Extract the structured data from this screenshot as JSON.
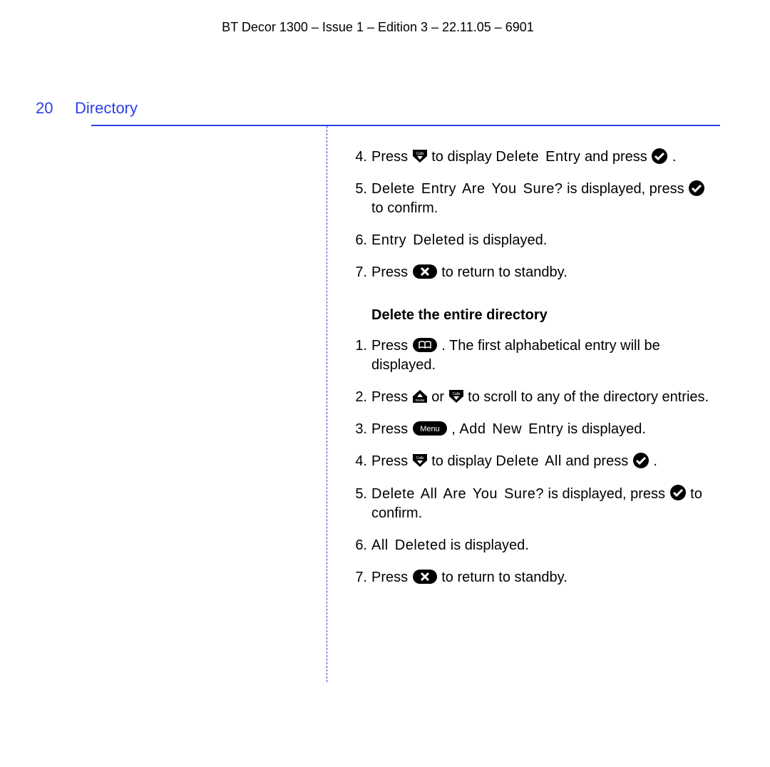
{
  "header": "BT Decor 1300 – Issue 1 – Edition 3 – 22.11.05 – 6901",
  "page_number": "20",
  "section_title": "Directory",
  "subheading": "Delete the entire directory",
  "section_a": {
    "step4_a": "Press ",
    "step4_b": " to display ",
    "step4_lcd": "Delete Entry",
    "step4_c": " and press ",
    "step4_d": ".",
    "step5_lcd": "Delete Entry Are You Sure?",
    "step5_a": " is displayed, press ",
    "step5_b": " to confirm.",
    "step6_lcd": "Entry Deleted",
    "step6_a": " is displayed.",
    "step7_a": "Press ",
    "step7_b": " to return to standby."
  },
  "section_b": {
    "step1_a": "Press ",
    "step1_b": ". The first alphabetical entry will be displayed.",
    "step2_a": "Press ",
    "step2_b": " or ",
    "step2_c": " to scroll to any of the directory entries.",
    "step3_a": "Press ",
    "step3_b": ", ",
    "step3_lcd": "Add New Entry",
    "step3_c": " is displayed.",
    "step4_a": "Press ",
    "step4_b": " to display ",
    "step4_lcd": "Delete All",
    "step4_c": " and press ",
    "step4_d": ".",
    "step5_lcd": "Delete All Are You Sure?",
    "step5_a": " is displayed, press ",
    "step5_b": " to confirm.",
    "step6_lcd": "All Deleted",
    "step6_a": " is displayed.",
    "step7_a": "Press ",
    "step7_b": " to return to standby."
  },
  "nums": {
    "n1": "1.",
    "n2": "2.",
    "n3": "3.",
    "n4": "4.",
    "n5": "5.",
    "n6": "6.",
    "n7": "7."
  },
  "icon_labels": {
    "calls": "Calls",
    "redial": "Redial",
    "menu": "Menu"
  }
}
